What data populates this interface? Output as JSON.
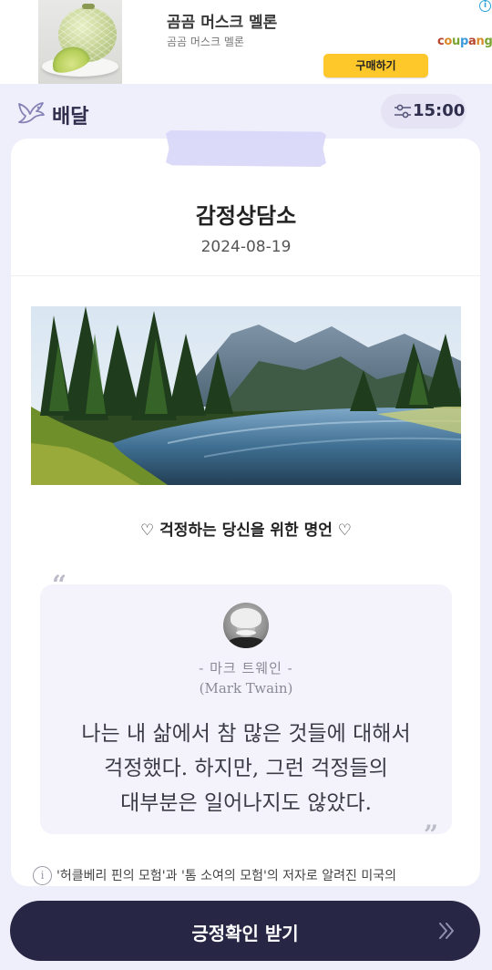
{
  "ad": {
    "title": "곰곰 머스크 멜론",
    "subtitle": "곰곰 머스크 멜론",
    "button_label": "구매하기",
    "info_glyph": "i",
    "brand": [
      "c",
      "o",
      "u",
      "p",
      "a",
      "n",
      "g"
    ],
    "image_icon": "melon-product-image"
  },
  "header": {
    "title": "배달",
    "logo_icon": "dove-icon",
    "timer_icon": "sliders-icon",
    "timer_text": "15:00"
  },
  "card": {
    "title": "감정상담소",
    "date": "2024-08-19",
    "image_icon": "landscape-river-image",
    "quote_heading": "♡ 걱정하는 당신을 위한 명언 ♡",
    "quote_open": "“",
    "quote_close": "”",
    "author_ko": "- 마크 트웨인 -",
    "author_en": "(Mark Twain)",
    "quote_line1": "나는 내 삶에서 참 많은 것들에 대해서",
    "quote_line2": "걱정했다. 하지만, 그런 걱정들의",
    "quote_line3": "대부분은 일어나지도 않았다.",
    "info_glyph": "i",
    "info_text": "'허클베리 핀의 모험'과 '톰 소여의 모험'의 저자로 알려진 미국의"
  },
  "cta": {
    "label": "긍정확인 받기",
    "chevron_icon": "double-chevron-right-icon"
  },
  "colors": {
    "background": "#efeefb",
    "accent_dark": "#272745",
    "ad_button": "#ffc82a",
    "quote_box": "#f4f3fc",
    "tape": "#d8d6f8"
  }
}
